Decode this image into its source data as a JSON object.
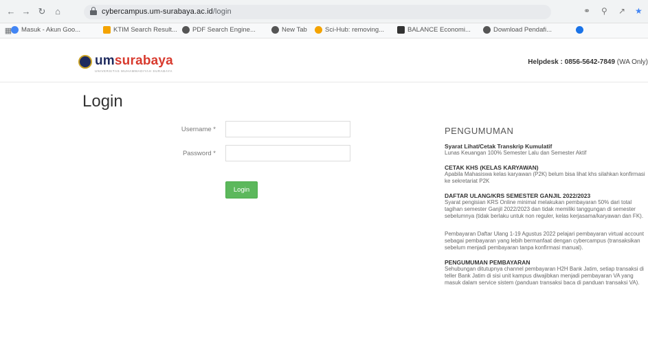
{
  "browser": {
    "url_host": "cybercampus.um-surabaya.ac.id",
    "url_path": "/login",
    "bookmarks": [
      {
        "label": "Masuk - Akun Goo...",
        "color": "#4285f4"
      },
      {
        "label": "KTIM Search Result...",
        "color": "#f4a300"
      },
      {
        "label": "PDF Search Engine...",
        "color": "#555555"
      },
      {
        "label": "New Tab",
        "color": "#555555"
      },
      {
        "label": "Sci-Hub: removing...",
        "color": "#f4a300"
      },
      {
        "label": "BALANCE Economi...",
        "color": "#333333"
      },
      {
        "label": "Download Pendafi...",
        "color": "#555555"
      }
    ]
  },
  "header": {
    "logo_um": "um",
    "logo_surabaya": "surabaya",
    "logo_sub": "UNIVERSITAS MUHAMMADIYAH SURABAYA",
    "helpdesk_label": "Helpdesk : 0856-5642-7849",
    "helpdesk_note": " (WA Only)"
  },
  "login": {
    "title": "Login",
    "username_label": "Username *",
    "password_label": "Password *",
    "username_value": "",
    "password_value": "",
    "button_label": "Login"
  },
  "announcements": {
    "title": "PENGUMUMAN",
    "items": [
      {
        "head": "Syarat Lihat/Cetak Transkrip Kumulatif",
        "body": "Lunas Keuangan 100% Semester Lalu dan Semester Aktif"
      },
      {
        "head": "CETAK KHS (KELAS KARYAWAN)",
        "body": "Apabila Mahasiswa kelas karyawan (P2K) belum bisa lihat khs silahkan konfirmasi ke sekretariat P2K"
      },
      {
        "head": "DAFTAR ULANG/KRS SEMESTER GANJIL 2022/2023",
        "body": "Syarat pengisian KRS Online minimal melakukan pembayaran 50% dari total tagihan semester Ganjil 2022/2023 dan tidak memiliki tanggungan di semester sebelumnya (tidak berlaku untuk non reguler, kelas kerjasama/karyawan dan FK)."
      },
      {
        "head": "",
        "body": "Pembayaran Daftar Ulang 1-19 Agustus 2022 pelajari pembayaran virtual account sebagai pembayaran yang lebih bermanfaat dengan cybercampus (transaksikan sebelum menjadi pembayaran tanpa konfirmasi manual)."
      },
      {
        "head": "PENGUMUMAN PEMBAYARAN",
        "body": "Sehubungan ditutupnya channel pembayaran H2H Bank Jatim, setiap transaksi di teller Bank Jatim di sisi unit kampus diwajibkan menjadi pembayaran VA yang masuk dalam service sistem (panduan transaksi baca di panduan transaksi VA)."
      }
    ]
  }
}
